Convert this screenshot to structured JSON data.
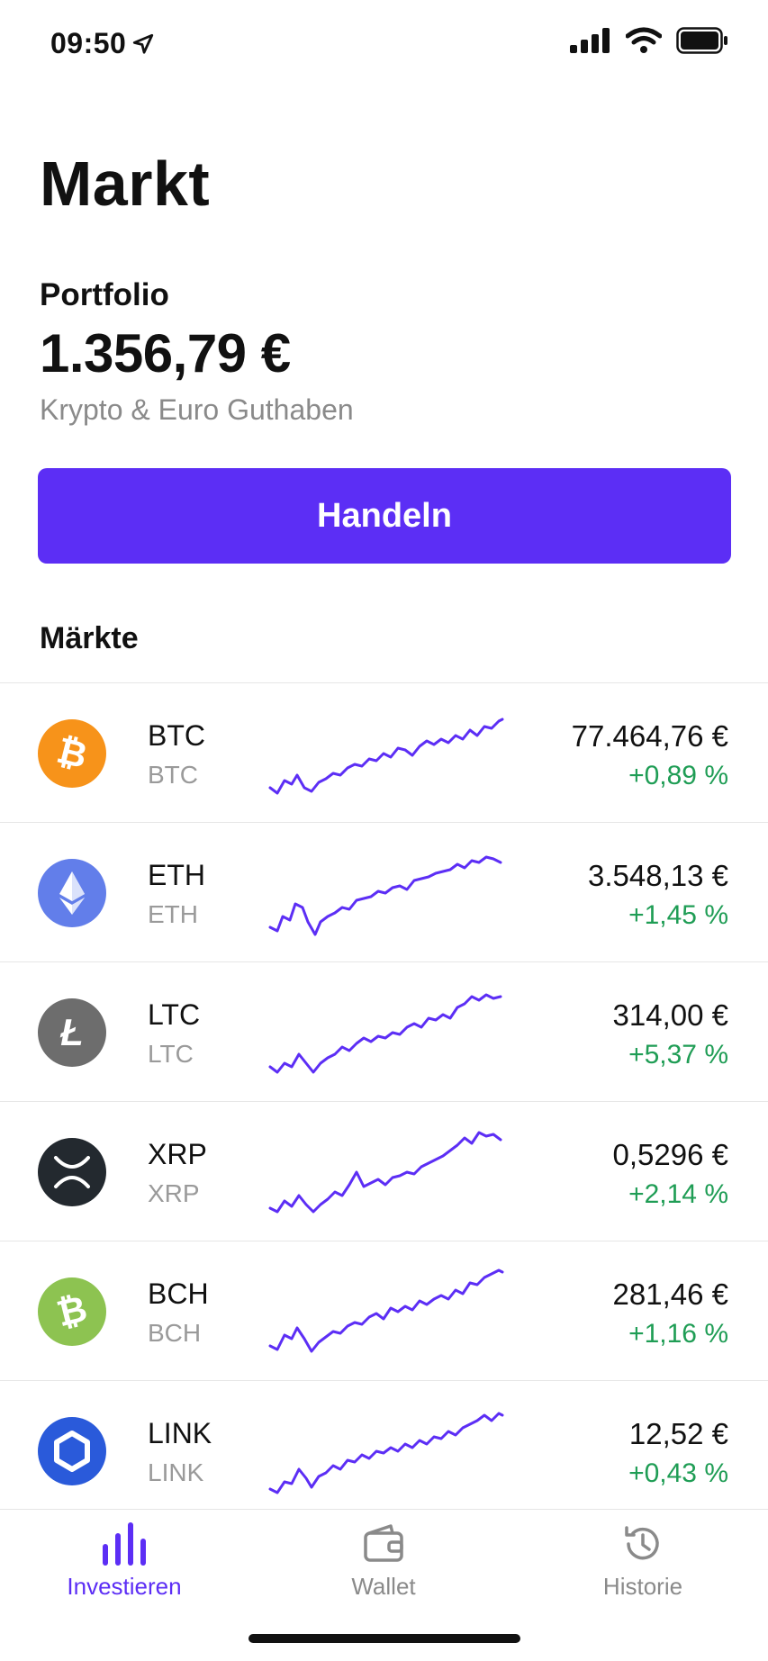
{
  "status": {
    "time": "09:50"
  },
  "page": {
    "title": "Markt"
  },
  "portfolio": {
    "label": "Portfolio",
    "value": "1.356,79 €",
    "subtitle": "Krypto & Euro Guthaben"
  },
  "actions": {
    "trade_label": "Handeln"
  },
  "markets": {
    "heading": "Märkte",
    "items": [
      {
        "name": "BTC",
        "ticker": "BTC",
        "price": "77.464,76 €",
        "change": "+0,89 %",
        "icon": "bitcoin-icon",
        "color": "#f7931a"
      },
      {
        "name": "ETH",
        "ticker": "ETH",
        "price": "3.548,13 €",
        "change": "+1,45 %",
        "icon": "ethereum-icon",
        "color": "#627eea"
      },
      {
        "name": "LTC",
        "ticker": "LTC",
        "price": "314,00 €",
        "change": "+5,37 %",
        "icon": "litecoin-icon",
        "color": "#6d6d6d"
      },
      {
        "name": "XRP",
        "ticker": "XRP",
        "price": "0,5296 €",
        "change": "+2,14 %",
        "icon": "xrp-icon",
        "color": "#23292f"
      },
      {
        "name": "BCH",
        "ticker": "BCH",
        "price": "281,46 €",
        "change": "+1,16 %",
        "icon": "bitcoin-cash-icon",
        "color": "#8dc351"
      },
      {
        "name": "LINK",
        "ticker": "LINK",
        "price": "12,52 €",
        "change": "+0,43 %",
        "icon": "chainlink-icon",
        "color": "#2a5ada"
      }
    ]
  },
  "colors": {
    "accent": "#5c2ef5",
    "positive": "#1f9d55",
    "sparkline": "#5c2ef5"
  },
  "tabs": [
    {
      "label": "Investieren",
      "icon": "bar-chart-icon",
      "active": true
    },
    {
      "label": "Wallet",
      "icon": "wallet-icon",
      "active": false
    },
    {
      "label": "Historie",
      "icon": "history-icon",
      "active": false
    }
  ]
}
